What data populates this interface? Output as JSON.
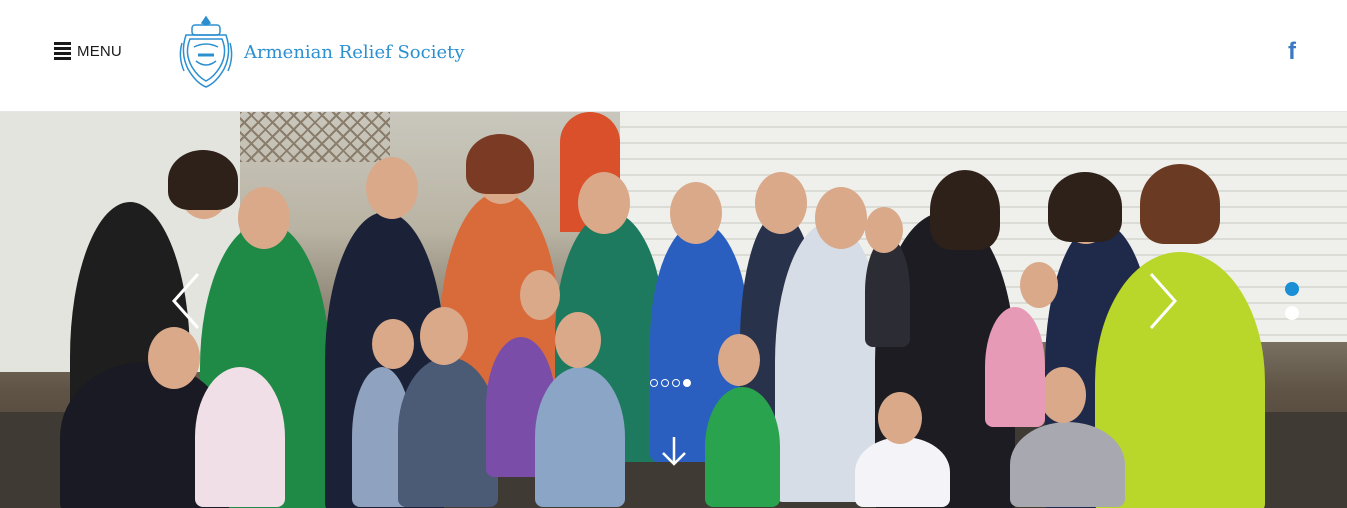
{
  "header": {
    "menu_label": "MENU",
    "menu_icon": "hamburger-icon",
    "logo_icon": "ars-emblem-icon",
    "logo_name": "Armenian Relief Society",
    "social": {
      "facebook_icon": "facebook-icon",
      "facebook_glyph": "f"
    }
  },
  "hero": {
    "prev_icon": "chevron-left-icon",
    "next_icon": "chevron-right-icon",
    "scroll_down_icon": "arrow-down-icon",
    "carousel_dots": {
      "count": 4,
      "active_index": 3
    },
    "section_dots": {
      "count": 2,
      "active_index": 0
    }
  },
  "colors": {
    "brand_blue": "#2b8fd0",
    "facebook_blue": "#3b79c4",
    "section_dot_active": "#1a8fd6"
  }
}
